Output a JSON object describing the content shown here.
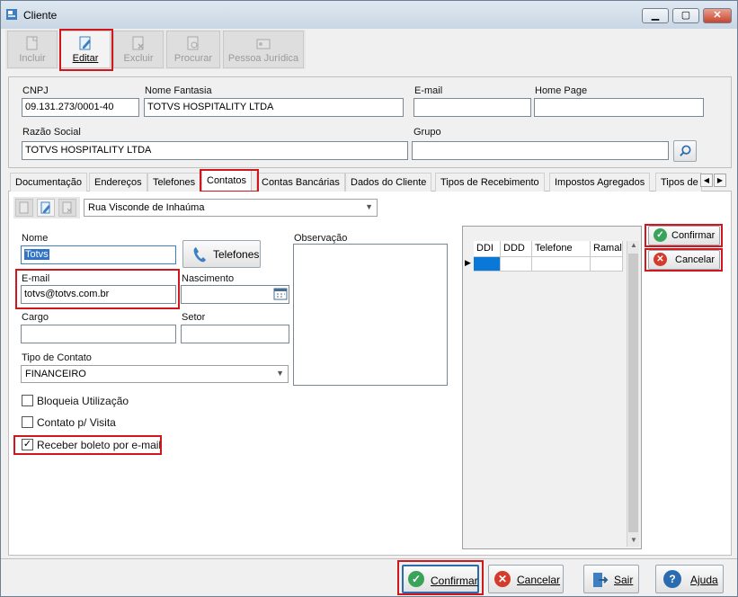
{
  "window": {
    "title": "Cliente",
    "min_label": "▁",
    "max_label": "▢",
    "close_label": "✕"
  },
  "toolbar": {
    "buttons": [
      {
        "label": "Incluir",
        "icon": "new-document-icon"
      },
      {
        "label": "Editar",
        "icon": "edit-document-icon"
      },
      {
        "label": "Excluir",
        "icon": "delete-document-icon"
      },
      {
        "label": "Procurar",
        "icon": "search-document-icon"
      },
      {
        "label": "Pessoa Jurídica",
        "icon": "id-card-icon"
      }
    ]
  },
  "header": {
    "cnpj_label": "CNPJ",
    "cnpj_value": "09.131.273/0001-40",
    "nome_fantasia_label": "Nome Fantasia",
    "nome_fantasia_value": "TOTVS HOSPITALITY LTDA",
    "email_label": "E-mail",
    "email_value": "",
    "home_page_label": "Home Page",
    "home_page_value": "",
    "razao_social_label": "Razão Social",
    "razao_social_value": "TOTVS HOSPITALITY LTDA",
    "grupo_label": "Grupo",
    "grupo_value": ""
  },
  "tabs": [
    {
      "label": "Documentação"
    },
    {
      "label": "Endereços"
    },
    {
      "label": "Telefones"
    },
    {
      "label": "Contatos"
    },
    {
      "label": "Contas Bancárias"
    },
    {
      "label": "Dados do Cliente"
    },
    {
      "label": "Tipos de Recebimento"
    },
    {
      "label": "Impostos Agregados"
    },
    {
      "label": "Tipos de"
    }
  ],
  "contact": {
    "address_select": "Rua Visconde de Inhaúma",
    "nome_label": "Nome",
    "nome_value": "Totvs",
    "telefones_button": "Telefones",
    "email_label": "E-mail",
    "email_value": "totvs@totvs.com.br",
    "nascimento_label": "Nascimento",
    "nascimento_value": "",
    "cargo_label": "Cargo",
    "cargo_value": "",
    "setor_label": "Setor",
    "setor_value": "",
    "tipo_contato_label": "Tipo de Contato",
    "tipo_contato_value": "FINANCEIRO",
    "observacao_label": "Observação",
    "bloqueia_label": "Bloqueia Utilização",
    "bloqueia_checked": false,
    "visita_label": "Contato p/ Visita",
    "visita_checked": false,
    "boleto_label": "Receber boleto por e-mail",
    "boleto_checked": true,
    "check_mark": "✓"
  },
  "phone_grid": {
    "columns": [
      "DDI",
      "DDD",
      "Telefone",
      "Ramal"
    ]
  },
  "side_actions": {
    "confirmar": "Confirmar",
    "cancelar": "Cancelar"
  },
  "footer": {
    "confirmar": "Confirmar",
    "cancelar": "Cancelar",
    "sair": "Sair",
    "ajuda": "Ajuda"
  },
  "colors": {
    "highlight": "#d1161c",
    "confirm_green": "#3aa35a",
    "cancel_red": "#d43b2c",
    "help_blue": "#2b6cb0"
  }
}
